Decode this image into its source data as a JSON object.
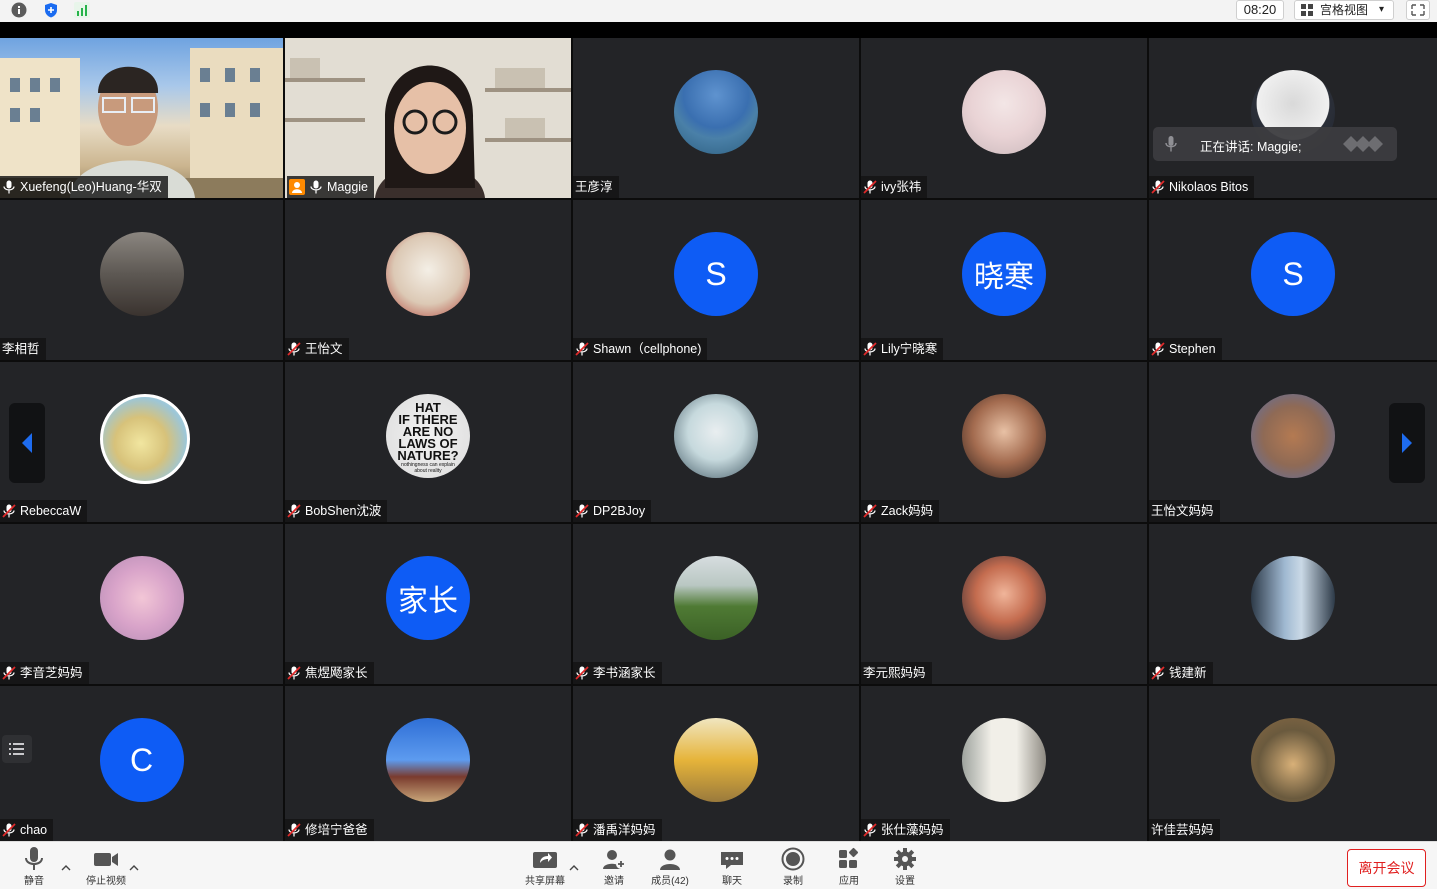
{
  "top_bar": {
    "time": "08:20",
    "view_mode": "宫格视图",
    "view_caret": "▾"
  },
  "speaking_indicator": "正在讲话: Maggie;",
  "participants": [
    {
      "name": "Xuefeng(Leo)Huang-华双",
      "muted": false,
      "type": "video"
    },
    {
      "name": "Maggie",
      "muted": false,
      "type": "video",
      "active_speaker": true
    },
    {
      "name": "王彦淳",
      "muted": null,
      "type": "photo"
    },
    {
      "name": "ivy张祎",
      "muted": true,
      "type": "photo"
    },
    {
      "name": "Nikolaos Bitos",
      "muted": true,
      "type": "photo"
    },
    {
      "name": "李相哲",
      "muted": null,
      "type": "photo"
    },
    {
      "name": "王怡文",
      "muted": true,
      "type": "photo"
    },
    {
      "name": "Shawn（cellphone)",
      "muted": true,
      "type": "letter",
      "letter": "S"
    },
    {
      "name": "Lily宁晓寒",
      "muted": true,
      "type": "letter",
      "letter": "晓寒"
    },
    {
      "name": "Stephen",
      "muted": true,
      "type": "letter",
      "letter": "S"
    },
    {
      "name": "RebeccaW",
      "muted": true,
      "type": "photo"
    },
    {
      "name": "BobShen沈波",
      "muted": true,
      "type": "photo",
      "avatar_text": [
        "HAT",
        "IF THERE",
        "ARE NO",
        "LAWS OF",
        "NATURE?",
        "nothingness can explain",
        "about reality"
      ]
    },
    {
      "name": "DP2BJoy",
      "muted": true,
      "type": "photo"
    },
    {
      "name": "Zack妈妈",
      "muted": true,
      "type": "photo"
    },
    {
      "name": "王怡文妈妈",
      "muted": null,
      "type": "photo"
    },
    {
      "name": "李音芝妈妈",
      "muted": true,
      "type": "photo"
    },
    {
      "name": "焦煜飏家长",
      "muted": true,
      "type": "letter",
      "letter": "家长"
    },
    {
      "name": "李书涵家长",
      "muted": true,
      "type": "photo"
    },
    {
      "name": "李元熙妈妈",
      "muted": null,
      "type": "photo"
    },
    {
      "name": "钱建新",
      "muted": true,
      "type": "photo"
    },
    {
      "name": "chao",
      "muted": true,
      "type": "letter",
      "letter": "C"
    },
    {
      "name": "修培宁爸爸",
      "muted": true,
      "type": "photo"
    },
    {
      "name": "潘禹洋妈妈",
      "muted": true,
      "type": "photo"
    },
    {
      "name": "张仕藻妈妈",
      "muted": true,
      "type": "photo"
    },
    {
      "name": "许佳芸妈妈",
      "muted": null,
      "type": "photo"
    }
  ],
  "toolbar": {
    "mute": "静音",
    "stop_video": "停止视频",
    "share_screen": "共享屏幕",
    "invite": "邀请",
    "participants": "成员(42)",
    "chat": "聊天",
    "record": "录制",
    "apps": "应用",
    "settings": "设置",
    "leave": "离开会议"
  },
  "colors": {
    "tile_bg": "#232427",
    "active_border": "#2bd35a",
    "avatar_blue": "#0e5cf5",
    "leave_red": "#e02020",
    "mic_muted": "#e02a2a",
    "nav_arrow": "#1e6cf0"
  },
  "icons": [
    "info-icon",
    "shield-icon",
    "signal-icon",
    "grid-view-icon",
    "fullscreen-icon",
    "mic-icon",
    "mic-muted-icon",
    "person-icon",
    "chevron-left-icon",
    "chevron-right-icon",
    "list-icon",
    "video-icon",
    "share-screen-icon",
    "invite-icon",
    "participants-icon",
    "chat-icon",
    "record-icon",
    "apps-icon",
    "settings-icon",
    "caret-up-icon"
  ]
}
